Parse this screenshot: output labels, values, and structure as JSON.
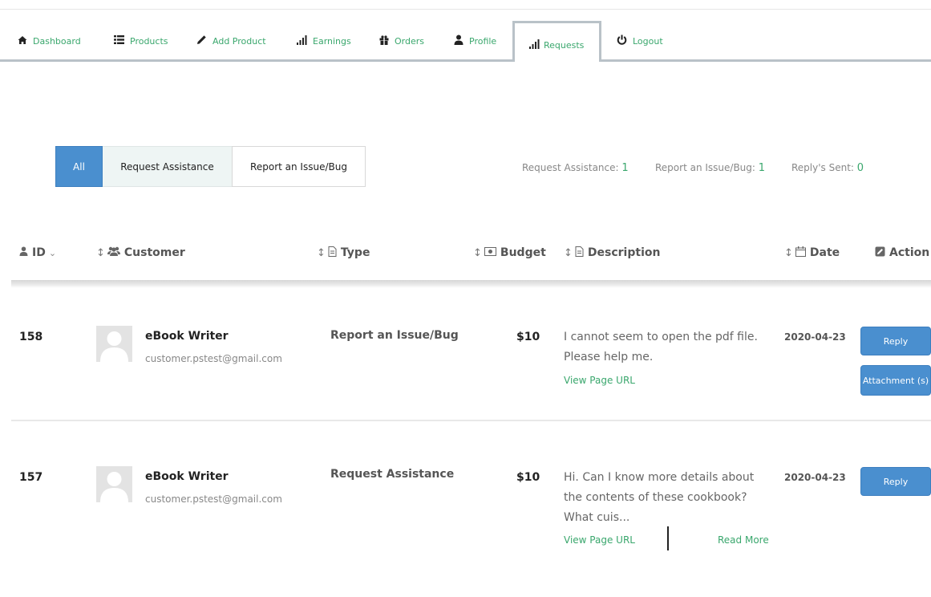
{
  "nav": {
    "items": [
      {
        "label": "Dashboard",
        "icon": "home-icon"
      },
      {
        "label": "Products",
        "icon": "list-icon"
      },
      {
        "label": "Add Product",
        "icon": "pencil-icon"
      },
      {
        "label": "Earnings",
        "icon": "signal-bars-icon"
      },
      {
        "label": "Orders",
        "icon": "gift-icon"
      },
      {
        "label": "Profile",
        "icon": "user-icon"
      },
      {
        "label": "Requests",
        "icon": "signal-bars-icon"
      },
      {
        "label": "Logout",
        "icon": "power-icon"
      }
    ],
    "active": "Requests",
    "accent_color": "#3aa76d"
  },
  "filters": {
    "all": "All",
    "request_assistance": "Request Assistance",
    "report_issue": "Report an Issue/Bug",
    "active": "All",
    "active_color": "#4a8fcf"
  },
  "counts": {
    "request_assistance_label": "Request Assistance:",
    "request_assistance_value": "1",
    "report_issue_label": "Report an Issue/Bug:",
    "report_issue_value": "1",
    "replies_label": "Reply's Sent:",
    "replies_value": "0"
  },
  "table": {
    "headers": {
      "id": "ID",
      "customer": "Customer",
      "type": "Type",
      "budget": "Budget",
      "description": "Description",
      "date": "Date",
      "action": "Action"
    },
    "rows": [
      {
        "id": "158",
        "customer_name": "eBook Writer",
        "customer_email": "customer.pstest@gmail.com",
        "type": "Report an Issue/Bug",
        "budget": "$10",
        "description_lines": [
          "I cannot seem to open the pdf file.",
          "Please help me."
        ],
        "view_url": "View Page URL",
        "date": "2020-04-23",
        "reply": "Reply",
        "attachment": "Attachment (s)"
      },
      {
        "id": "157",
        "customer_name": "eBook Writer",
        "customer_email": "customer.pstest@gmail.com",
        "type": "Request Assistance",
        "budget": "$10",
        "description_lines": [
          "Hi. Can I know more details about",
          "the contents of these cookbook?",
          "What cuis..."
        ],
        "view_url": "View Page URL",
        "read_more": "Read More",
        "date": "2020-04-23",
        "reply": "Reply"
      }
    ]
  }
}
